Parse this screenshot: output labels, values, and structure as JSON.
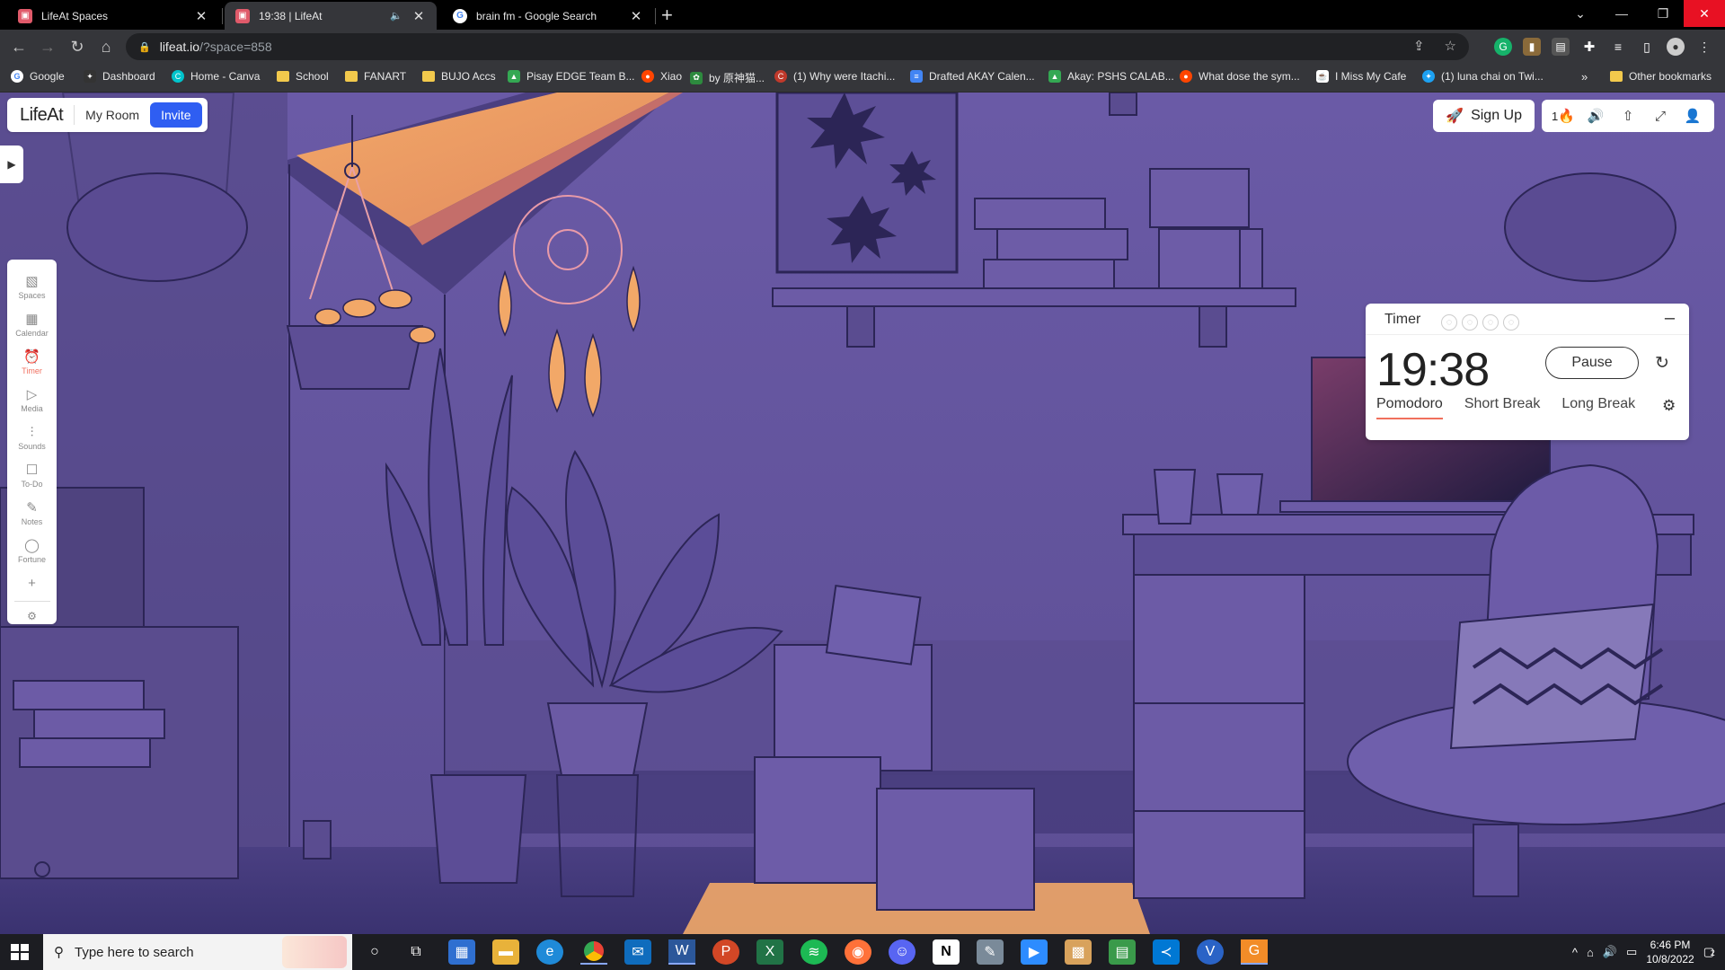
{
  "browser": {
    "tabs": [
      {
        "title": "LifeAt Spaces",
        "active": false
      },
      {
        "title": "19:38 | LifeAt",
        "active": true
      },
      {
        "title": "brain fm - Google Search",
        "active": false
      }
    ],
    "url_host": "lifeat.io",
    "url_path": "/?space=858",
    "bookmarks": [
      "Google",
      "Dashboard",
      "Home - Canva",
      "School",
      "FANART",
      "BUJO Accs",
      "Pisay EDGE Team B...",
      "Xiao",
      "by 原神猫...",
      "(1) Why were Itachi...",
      "Drafted AKAY Calen...",
      "Akay: PSHS CALAB...",
      "What dose the sym...",
      "I Miss My Cafe",
      "(1) luna chai on Twi..."
    ],
    "other_bookmarks": "Other bookmarks"
  },
  "app": {
    "logo": "LifeAt",
    "my_room": "My Room",
    "invite": "Invite",
    "sign_up": "Sign Up",
    "streak": "1",
    "sidebar": [
      {
        "label": "Spaces",
        "icon": "image-icon"
      },
      {
        "label": "Calendar",
        "icon": "calendar-icon"
      },
      {
        "label": "Timer",
        "icon": "alarm-clock-icon",
        "active": true
      },
      {
        "label": "Media",
        "icon": "play-icon"
      },
      {
        "label": "Sounds",
        "icon": "sliders-icon"
      },
      {
        "label": "To-Do",
        "icon": "checklist-icon"
      },
      {
        "label": "Notes",
        "icon": "pencil-icon"
      },
      {
        "label": "Fortune",
        "icon": "fortune-icon"
      }
    ],
    "timer": {
      "title": "Timer",
      "time": "19:38",
      "pause_label": "Pause",
      "modes": [
        "Pomodoro",
        "Short Break",
        "Long Break"
      ],
      "active_mode": "Pomodoro"
    }
  },
  "taskbar": {
    "search_placeholder": "Type here to search",
    "time": "6:46 PM",
    "date": "10/8/2022",
    "notification_count": "2"
  },
  "colors": {
    "accent_invite": "#2f5ef2",
    "timer_active": "#f07060",
    "scene_base": "#6b5aa2",
    "sunlight": "#f2a868"
  }
}
